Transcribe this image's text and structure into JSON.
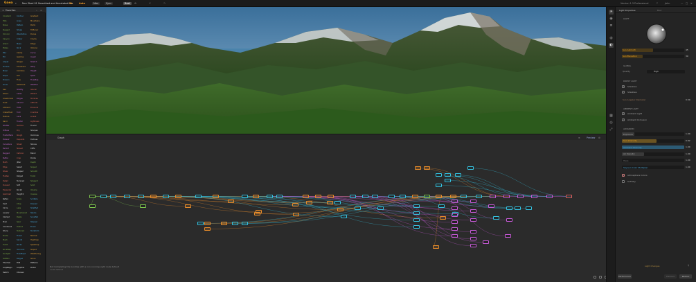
{
  "topbar": {
    "logo": "Gaea",
    "project": "Non Shed 01 Smoothed and Annotated.terr",
    "r1": "2k",
    "r2": "Auto",
    "tabs": [
      "Max",
      "Sync",
      "Beat"
    ],
    "version": "Version 1.3 Professional",
    "user": "John"
  },
  "library": {
    "title": "Favorites",
    "items": [
      [
        "Constant",
        "Contour",
        "Gradient"
      ],
      [
        "Hills",
        "Lines",
        "Mountains"
      ],
      [
        "Noise",
        "Pattern",
        "Perlin"
      ],
      [
        "Rugged",
        "Shape",
        "TriPlanar"
      ],
      [
        "Voronoi",
        "WaveShine",
        "Dunes"
      ],
      [
        "Canyon",
        "Crater",
        "Cracks"
      ],
      [
        "Island",
        "Mesa",
        "Ridge"
      ],
      [
        "Plates",
        "Rock",
        "Volcano"
      ],
      [
        "Blur",
        "Clamp",
        "Curve"
      ],
      [
        "Fill",
        "Gamma",
        "Invert"
      ],
      [
        "Adjust",
        "Shaper",
        "Stretch"
      ],
      [
        "Terrace",
        "Threshold",
        "Warp"
      ],
      [
        "Mixer",
        "Combine",
        "Height"
      ],
      [
        "Slope",
        "Soil",
        "Splat"
      ],
      [
        "Erosion",
        "Flow",
        "FlowMap"
      ],
      [
        "Snow",
        "Sediment",
        "Weather"
      ],
      [
        "Sea",
        "Stratify",
        "Glacier"
      ],
      [
        "Rivers",
        "Lakes",
        "Wizard"
      ],
      [
        "Anastomosis",
        "Ridges",
        "Terraces"
      ],
      [
        "Dusk",
        "Alluvial",
        "Altitude"
      ],
      [
        "Ambient",
        "Fade",
        "Erosion2"
      ],
      [
        "CraterField",
        "Fold",
        "Crumble"
      ],
      [
        "Texture",
        "Lava",
        "Lines2"
      ],
      [
        "Sand",
        "Fractal",
        "Lightness"
      ],
      [
        "Shatter",
        "Surface",
        "Fluvial"
      ],
      [
        "Diffuse",
        "Dry",
        "Sharpen"
      ],
      [
        "FractalTerraces",
        "Rough",
        "Outcrops"
      ],
      [
        "Plates2",
        "Deposits",
        "Distress"
      ],
      [
        "Curvature",
        "Sheet",
        "Stones"
      ],
      [
        "Perlin2",
        "Noise2",
        "Cliffs"
      ],
      [
        "Rugged",
        "Cartoon",
        "Blend"
      ],
      [
        "Buffer",
        "Crop",
        "Points"
      ],
      [
        "Math",
        "Jitter",
        "Depth"
      ],
      [
        "Edge",
        "Select",
        "Slope2"
      ],
      [
        "Shear",
        "Shape2",
        "Smooth"
      ],
      [
        "Flatten",
        "Ridged",
        "Fold2"
      ],
      [
        "Detail",
        "Terrace2",
        "Shaper2"
      ],
      [
        "Dunes2",
        "Soft",
        "Solid"
      ],
      [
        "Expander",
        "Rock2",
        "Volume"
      ],
      [
        "Gamma2",
        "Height2",
        "Inverse"
      ],
      [
        "Reflex",
        "Scale",
        "Scribble"
      ],
      [
        "Swirl",
        "Chop",
        "Rivers2"
      ],
      [
        "Circle",
        "Lake",
        "Stratify2"
      ],
      [
        "Leveler",
        "Mountains2",
        "Stacks"
      ],
      [
        "Clamp2",
        "Peaks",
        "Snowfall"
      ],
      [
        "Pixel",
        "Spec",
        "Stepper"
      ],
      [
        "Combine2",
        "Distort",
        "Brush"
      ],
      [
        "Sharp",
        "Texture2",
        "Terraform"
      ],
      [
        "Erode",
        "Flow2",
        "Normal"
      ],
      [
        "Mesh",
        "Sand2",
        "Heatmap"
      ],
      [
        "Fold3",
        "Rocks",
        "Splatmap"
      ],
      [
        "RockMap",
        "Voronoi2",
        "Slope3"
      ],
      [
        "Sunlight",
        "FlowMap2",
        "Weathering"
      ],
      [
        "SoftMin",
        "Ridge2",
        "Shore"
      ],
      [
        "Thermal",
        "Fill2",
        "Patterns"
      ],
      [
        "LoopBegin",
        "LoopEnd",
        "Portal"
      ],
      [
        "Switch",
        "Chooser",
        ""
      ]
    ]
  },
  "graph": {
    "title": "Graph",
    "preview_label": "Preview",
    "status": "Not Completing the bundles with a non-running Light node default"
  },
  "properties": {
    "title": "Light Properties",
    "search": "Find",
    "sec_light": "LIGHT",
    "sun_azimuth": {
      "label": "Sun Azimuth",
      "value": "45",
      "level": 0.5
    },
    "sun_elevation": {
      "label": "Sun Elevation",
      "value": "30",
      "level": 0.33
    },
    "sec_global": "GLOBAL",
    "quality": {
      "label": "Quality",
      "value": "High"
    },
    "sec_direct": "DIRECT LIGHT",
    "shadows": "Shadows",
    "shadows2": "Shadows",
    "sun_angular": {
      "label": "Sun Angular Diameter",
      "value": "0.50"
    },
    "sec_ambient": "AMBIENT LIGHT",
    "ambient_light": "Ambient Light",
    "ambient_occlusion": "Ambient Occlusion",
    "sec_advanced": "ADVANCED",
    "exposure": {
      "label": "Exposure",
      "value": "1.00",
      "level": 0.2
    },
    "sun_intensity": {
      "label": "Sun Intensity",
      "value": "6.82",
      "level": 0.55
    },
    "ambient_intensity": {
      "label": "Ambient Intensity",
      "value": "1.00",
      "level": 1.0
    },
    "air_density": {
      "label": "Air Density",
      "value": "1.00",
      "level": 0.35
    },
    "haze": {
      "label": "Haze",
      "value": "1.00",
      "level": 0.0
    },
    "sky_color": {
      "label": "Sky/sun Color Multiplier",
      "value": "1.00",
      "level": 0.0
    },
    "atmosphere": "Atmosphere Colors",
    "soft_sky": "Soft sky",
    "footer_link": "Light Changes",
    "btn_left": "Performance",
    "btn_mid": "Previous",
    "btn_right": "Restore"
  }
}
